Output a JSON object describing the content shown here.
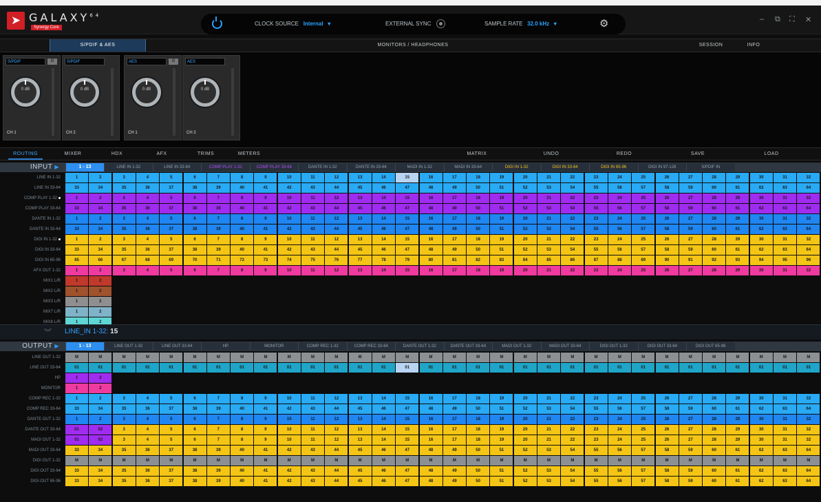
{
  "app": {
    "brand": "GALAXY",
    "brand_sup": "64",
    "brand_sub": "Synergy Core"
  },
  "toolbar": {
    "clock_source_label": "CLOCK SOURCE",
    "clock_source_value": "Internal",
    "external_sync_label": "EXTERNAL SYNC",
    "sample_rate_label": "SAMPLE RATE",
    "sample_rate_value": "32.0 kHz"
  },
  "window_controls": {
    "minimize": "–",
    "restore": "⧉",
    "fullscreen": "⛶",
    "close": "✕"
  },
  "top_tabs": [
    "S/PDIF & AES",
    "MONITORS / HEADPHONES",
    "SESSION",
    "INFO"
  ],
  "channels": [
    {
      "name": "S/PDIF",
      "switch": "Ø",
      "gain": "0 dB",
      "ch": "CH 1"
    },
    {
      "name": "S/PDIF",
      "switch": "",
      "gain": "0 dB",
      "ch": "CH 2"
    },
    {
      "name": "AES",
      "switch": "Ø",
      "gain": "0 dB",
      "ch": "CH 1"
    },
    {
      "name": "AES",
      "switch": "",
      "gain": "0 dB",
      "ch": "CH 2"
    }
  ],
  "sub_tabs": [
    "ROUTING",
    "MIXER",
    "HDX",
    "AFX",
    "TRIMS",
    "METERS"
  ],
  "actions": [
    "MATRIX",
    "UNDO",
    "REDO",
    "SAVE",
    "LOAD"
  ],
  "input": {
    "title": "INPUT",
    "tabs": [
      "1 - 13",
      "LINE IN 1-32",
      "LINE IN 33-64",
      "COMP PLAY 1-32",
      "COMP PLAY 33-64",
      "DANTE IN 1-32",
      "DANTE IN 33-64",
      "MADI IN 1-32",
      "MADI IN 33-64",
      "DIGI IN 1-32",
      "DIGI IN 33-64",
      "DIGI IN 65-96",
      "DIGI IN 97-128",
      "S/PDIF IN"
    ],
    "rows": [
      {
        "label": "LINE IN 1-32",
        "color": "#29aaf4",
        "start": 1,
        "count": 32,
        "highlight": 15
      },
      {
        "label": "LINE IN 33-64",
        "color": "#29aaf4",
        "start": 33,
        "count": 32
      },
      {
        "label": "COMP PLAY 1-32",
        "color": "#a02cf0",
        "start": 1,
        "count": 32,
        "dot": true
      },
      {
        "label": "COMP PLAY 33-64",
        "color": "#a02cf0",
        "start": 33,
        "count": 32
      },
      {
        "label": "DANTE IN 1-32",
        "color": "#1f86f2",
        "start": 1,
        "count": 32
      },
      {
        "label": "DANTE IN 33-64",
        "color": "#1f86f2",
        "start": 33,
        "count": 32
      },
      {
        "label": "DIGI IN 1-32",
        "color": "#f4c514",
        "start": 1,
        "count": 32,
        "dot": true
      },
      {
        "label": "DIGI IN 33-64",
        "color": "#f4c514",
        "start": 33,
        "count": 32
      },
      {
        "label": "DIGI IN 65-96",
        "color": "#f4c514",
        "start": 65,
        "count": 32
      },
      {
        "label": "AFX OUT 1-32",
        "color": "#ef3aa0",
        "start": 1,
        "count": 32
      },
      {
        "label": "MIX1 L/R",
        "color": "#c0392b",
        "start": 1,
        "count": 2
      },
      {
        "label": "MIX2 L/R",
        "color": "#a0522d",
        "start": 1,
        "count": 2
      },
      {
        "label": "MIX3 L/R",
        "color": "#8f8f8f",
        "start": 1,
        "count": 2
      },
      {
        "label": "MIX7 L/R",
        "color": "#7fb3c8",
        "start": 1,
        "count": 2
      },
      {
        "label": "MIX8 L/R",
        "color": "#5ed6d6",
        "start": 1,
        "count": 2
      }
    ]
  },
  "divider": {
    "prefix": "LINE_IN 1-32:",
    "value": "15"
  },
  "output": {
    "title": "OUTPUT",
    "tabs": [
      "1 - 13",
      "LINE OUT 1-32",
      "LINE OUT 33-64",
      "HP",
      "MONITOR",
      "COMP REC 1-32",
      "COMP REC 33-64",
      "DANTE OUT 1-32",
      "DANTE OUT 33-64",
      "MADI OUT 1-32",
      "MADI OUT 33-64",
      "DIGI OUT 1-32",
      "DIGI OUT 33-64",
      "DIGI OUT 65-96"
    ],
    "rows": [
      {
        "label": "LINE OUT 1-32",
        "color": "#8d9093",
        "text": "M",
        "count": 32
      },
      {
        "label": "LINE OUT 33-64",
        "color": "#1fa5c8",
        "text": "01",
        "count": 32,
        "highlight": 15
      },
      {
        "label": "HP",
        "color": "#a02cf0",
        "start": 1,
        "count": 2
      },
      {
        "label": "MONITOR",
        "color": "#ef3aa0",
        "start": 1,
        "count": 2
      },
      {
        "label": "COMP REC 1-32",
        "color": "#29aaf4",
        "start": 1,
        "count": 32
      },
      {
        "label": "COMP REC 33-64",
        "color": "#29aaf4",
        "start": 33,
        "count": 32
      },
      {
        "label": "DANTE OUT 1-32",
        "color": "#1f86f2",
        "start": 1,
        "count": 32
      },
      {
        "label": "DANTE OUT 33-64",
        "color": "#f4c514",
        "start": 1,
        "count": 32,
        "lead": [
          "01",
          "02"
        ],
        "lead_color": "#a02cf0"
      },
      {
        "label": "MADI OUT 1-32",
        "color": "#f4c514",
        "start": 1,
        "count": 32,
        "lead": [
          "01",
          "02"
        ],
        "lead_color": "#a02cf0"
      },
      {
        "label": "MADI OUT 33-64",
        "color": "#f4c514",
        "start": 33,
        "count": 32
      },
      {
        "label": "DIGI OUT 1-32",
        "color": "#8d9093",
        "text": "M",
        "count": 32
      },
      {
        "label": "DIGI OUT 33-64",
        "color": "#f4c514",
        "start": 33,
        "count": 32
      },
      {
        "label": "DIGI OUT 65-96",
        "color": "#f4c514",
        "start": 33,
        "count": 32
      }
    ]
  }
}
